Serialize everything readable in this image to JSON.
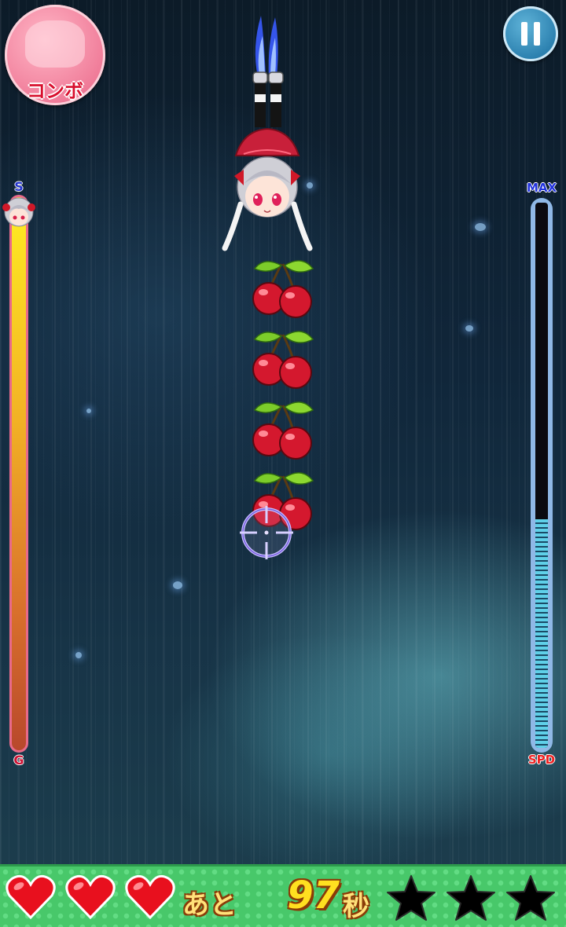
{
  "hud": {
    "combo_label": "コンボ",
    "pause_icon": "pause-icon"
  },
  "progress": {
    "top_label": "S",
    "bottom_label": "G",
    "position_fraction": 0.0
  },
  "speed": {
    "top_label": "MAX",
    "bottom_label": "SPD",
    "level_fraction": 0.42
  },
  "items": {
    "cherry_count": 4,
    "icon": "cherry-icon"
  },
  "status": {
    "hearts": 3,
    "remain_label": "あと",
    "time_remaining": "97",
    "time_unit": "秒",
    "stars_earned": 0,
    "stars_total": 3
  },
  "colors": {
    "combo_badge": "#f07c99",
    "pause_button": "#2a7fae",
    "bottom_bar": "#48c86a",
    "heart": "#e8101e",
    "star": "#000000"
  }
}
